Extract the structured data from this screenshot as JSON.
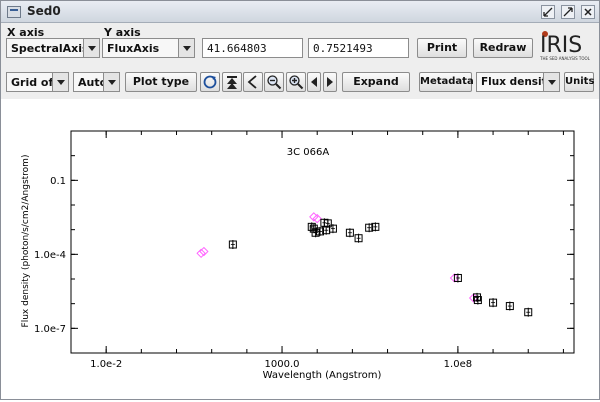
{
  "window": {
    "title": "Sed0",
    "controls": {
      "minimize": "minimize-icon",
      "restore": "restore-icon",
      "close": "close-icon"
    }
  },
  "axes_controls": {
    "x_label": "X axis",
    "y_label": "Y axis",
    "x_axis_value": "SpectralAxis",
    "y_axis_value": "FluxAxis",
    "x_coordinate": "41.664803",
    "y_coordinate": "0.7521493"
  },
  "toolbar": {
    "print_label": "Print",
    "redraw_label": "Redraw",
    "grid_value": "Grid off",
    "scale_value": "Auto",
    "plot_type_label": "Plot type",
    "expand_label": "Expand",
    "metadata_label": "Metadata",
    "flux_value": "Flux density",
    "units_label": "Units",
    "icon_buttons": [
      "refresh-icon",
      "top-icon",
      "chevron-left-icon",
      "zoom-out-icon",
      "zoom-in-icon",
      "arrow-left-icon",
      "arrow-right-icon"
    ]
  },
  "logo": {
    "text": "IRIS",
    "tagline": "THE SED ANALYSIS TOOL"
  },
  "chart_data": {
    "type": "scatter",
    "title": "3C 066A",
    "xlabel": "Wavelength (Angstrom)",
    "ylabel": "Flux density (photon/s/cm2/Angstrom)",
    "x_scale": "log",
    "y_scale": "log",
    "xlim": [
      0.001,
      200000000000
    ],
    "ylim": [
      1e-08,
      10
    ],
    "x_ticks": [
      {
        "value": 0.01,
        "label": "1.0e-2"
      },
      {
        "value": 1000,
        "label": "1000.0"
      },
      {
        "value": 100000000,
        "label": "1.0e8"
      }
    ],
    "y_ticks": [
      {
        "value": 1e-07,
        "label": "1.0e-7"
      },
      {
        "value": 0.0001,
        "label": "1.0e-4"
      },
      {
        "value": 0.1,
        "label": "0.1"
      }
    ],
    "grid": false,
    "series": [
      {
        "marker": "diamond",
        "color": "#ff66ff",
        "points": [
          {
            "x": 5,
            "y": 0.00011
          },
          {
            "x": 6,
            "y": 0.00013
          },
          {
            "x": 8000,
            "y": 0.0033
          },
          {
            "x": 10000,
            "y": 0.0028
          },
          {
            "x": 80000000,
            "y": 1.1e-05
          },
          {
            "x": 280000000,
            "y": 1.7e-06
          }
        ]
      },
      {
        "marker": "square-crosshair",
        "color": "#000000",
        "points": [
          {
            "x": 40,
            "y": 0.00025
          },
          {
            "x": 7000,
            "y": 0.0013
          },
          {
            "x": 8000,
            "y": 0.0011
          },
          {
            "x": 9000,
            "y": 0.00075
          },
          {
            "x": 12000,
            "y": 0.00085
          },
          {
            "x": 16000,
            "y": 0.0019
          },
          {
            "x": 18000,
            "y": 0.00095
          },
          {
            "x": 20000,
            "y": 0.0018
          },
          {
            "x": 28000,
            "y": 0.0011
          },
          {
            "x": 85000,
            "y": 0.00075
          },
          {
            "x": 150000,
            "y": 0.00045
          },
          {
            "x": 300000,
            "y": 0.0012
          },
          {
            "x": 450000,
            "y": 0.0013
          },
          {
            "x": 100000000,
            "y": 1.1e-05
          },
          {
            "x": 350000000,
            "y": 1.8e-06
          },
          {
            "x": 370000000,
            "y": 1.4e-06
          },
          {
            "x": 1000000000,
            "y": 1.1e-06
          },
          {
            "x": 3000000000,
            "y": 8e-07
          },
          {
            "x": 10000000000,
            "y": 4.5e-07
          }
        ]
      }
    ]
  }
}
